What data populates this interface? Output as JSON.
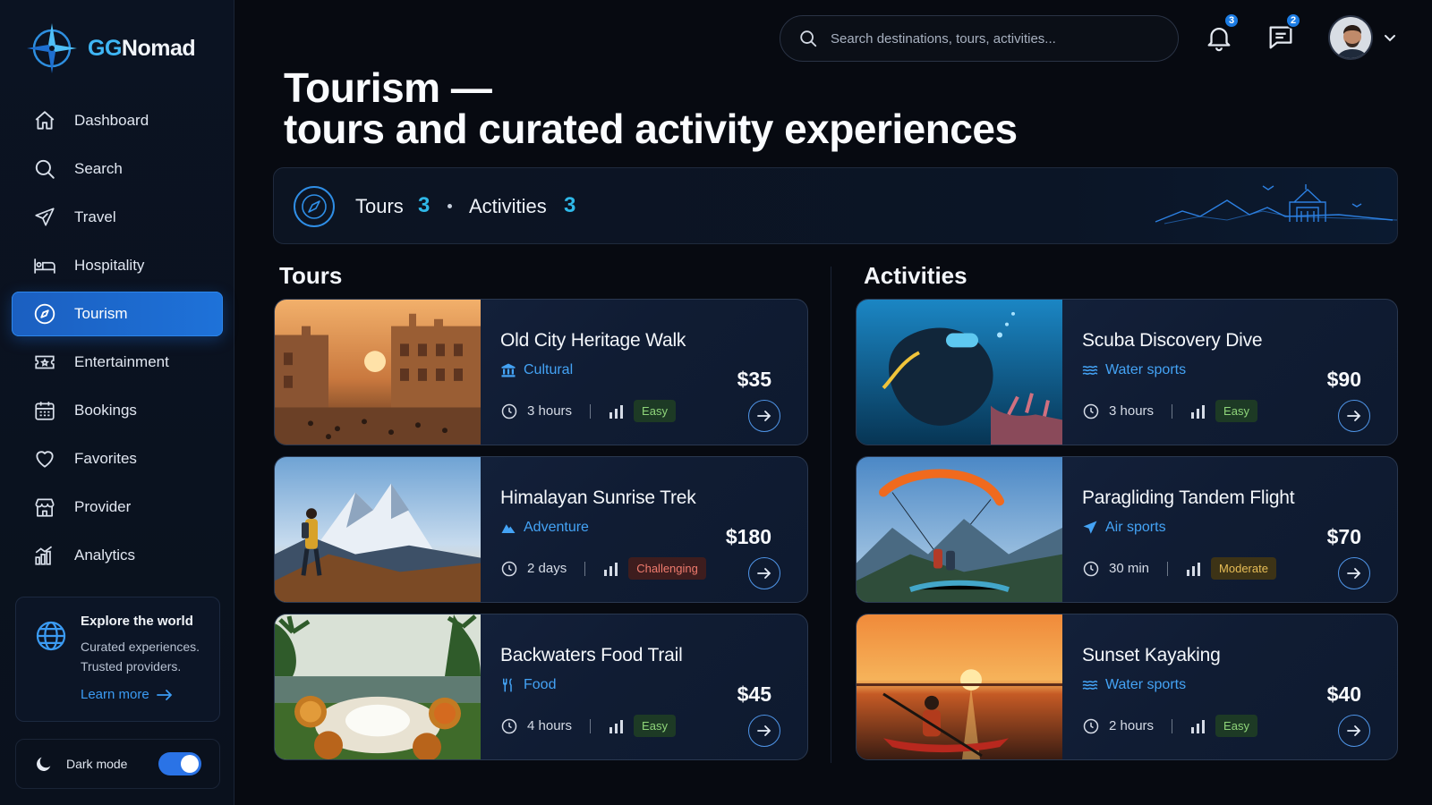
{
  "app": {
    "brand_prefix": "GG",
    "brand_suffix": "Nomad",
    "accent": "#1e72d9"
  },
  "sidebar": {
    "items": [
      {
        "label": "Dashboard",
        "icon": "home-icon"
      },
      {
        "label": "Search",
        "icon": "search-icon"
      },
      {
        "label": "Travel",
        "icon": "plane-icon"
      },
      {
        "label": "Hospitality",
        "icon": "bed-icon"
      },
      {
        "label": "Tourism",
        "icon": "compass-icon",
        "active": true
      },
      {
        "label": "Entertainment",
        "icon": "ticket-icon"
      },
      {
        "label": "Bookings",
        "icon": "calendar-icon"
      },
      {
        "label": "Favorites",
        "icon": "heart-icon"
      },
      {
        "label": "Provider",
        "icon": "storefront-icon"
      },
      {
        "label": "Analytics",
        "icon": "bar-chart-icon"
      }
    ],
    "explore": {
      "title": "Explore the world",
      "line1": "Curated experiences.",
      "line2": "Trusted providers.",
      "link": "Learn more"
    },
    "dark_mode": {
      "label": "Dark mode",
      "enabled": true
    }
  },
  "topbar": {
    "search_placeholder": "Search destinations, tours, activities...",
    "notifications_count": "3",
    "messages_count": "2"
  },
  "page": {
    "title_line1": "Tourism —",
    "title_line2": "tours and curated activity experiences"
  },
  "stats": {
    "tours_label": "Tours",
    "tours_count": "3",
    "activities_label": "Activities",
    "activities_count": "3"
  },
  "tours": {
    "heading": "Tours",
    "items": [
      {
        "title": "Old City Heritage Walk",
        "category": "Cultural",
        "category_icon": "museum-icon",
        "duration": "3 hours",
        "difficulty": "Easy",
        "price": "$35"
      },
      {
        "title": "Himalayan Sunrise Trek",
        "category": "Adventure",
        "category_icon": "mountain-icon",
        "duration": "2 days",
        "difficulty": "Challenging",
        "price": "$180"
      },
      {
        "title": "Backwaters Food Trail",
        "category": "Food",
        "category_icon": "utensils-icon",
        "duration": "4 hours",
        "difficulty": "Easy",
        "price": "$45"
      }
    ]
  },
  "activities": {
    "heading": "Activities",
    "items": [
      {
        "title": "Scuba Discovery Dive",
        "category": "Water sports",
        "category_icon": "waves-icon",
        "duration": "3 hours",
        "difficulty": "Easy",
        "price": "$90"
      },
      {
        "title": "Paragliding Tandem Flight",
        "category": "Air sports",
        "category_icon": "paper-plane-icon",
        "duration": "30 min",
        "difficulty": "Moderate",
        "price": "$70"
      },
      {
        "title": "Sunset Kayaking",
        "category": "Water sports",
        "category_icon": "waves-icon",
        "duration": "2 hours",
        "difficulty": "Easy",
        "price": "$40"
      }
    ]
  }
}
